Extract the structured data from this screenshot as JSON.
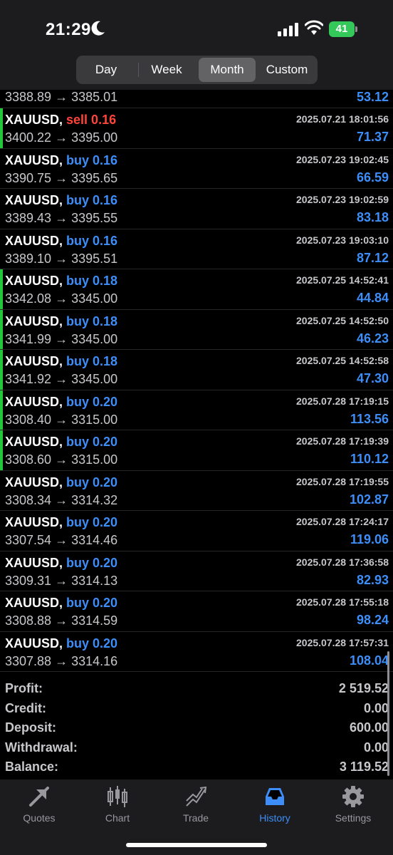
{
  "status": {
    "time": "21:29",
    "battery": "41"
  },
  "periods": [
    "Day",
    "Week",
    "Month",
    "Custom"
  ],
  "active_period": "Month",
  "first_row": {
    "prices": "3388.89 → 3385.01",
    "profit": "53.12"
  },
  "deals": [
    {
      "symbol": "XAUUSD,",
      "side": "sell",
      "side_text": "sell 0.16",
      "date": "2025.07.21 18:01:56",
      "prices": "3400.22 → 3395.00",
      "profit": "71.37",
      "marker": true
    },
    {
      "symbol": "XAUUSD,",
      "side": "buy",
      "side_text": "buy 0.16",
      "date": "2025.07.23 19:02:45",
      "prices": "3390.75 → 3395.65",
      "profit": "66.59",
      "marker": false
    },
    {
      "symbol": "XAUUSD,",
      "side": "buy",
      "side_text": "buy 0.16",
      "date": "2025.07.23 19:02:59",
      "prices": "3389.43 → 3395.55",
      "profit": "83.18",
      "marker": false
    },
    {
      "symbol": "XAUUSD,",
      "side": "buy",
      "side_text": "buy 0.16",
      "date": "2025.07.23 19:03:10",
      "prices": "3389.10 → 3395.51",
      "profit": "87.12",
      "marker": false
    },
    {
      "symbol": "XAUUSD,",
      "side": "buy",
      "side_text": "buy 0.18",
      "date": "2025.07.25 14:52:41",
      "prices": "3342.08 → 3345.00",
      "profit": "44.84",
      "marker": true
    },
    {
      "symbol": "XAUUSD,",
      "side": "buy",
      "side_text": "buy 0.18",
      "date": "2025.07.25 14:52:50",
      "prices": "3341.99 → 3345.00",
      "profit": "46.23",
      "marker": true
    },
    {
      "symbol": "XAUUSD,",
      "side": "buy",
      "side_text": "buy 0.18",
      "date": "2025.07.25 14:52:58",
      "prices": "3341.92 → 3345.00",
      "profit": "47.30",
      "marker": true
    },
    {
      "symbol": "XAUUSD,",
      "side": "buy",
      "side_text": "buy 0.20",
      "date": "2025.07.28 17:19:15",
      "prices": "3308.40 → 3315.00",
      "profit": "113.56",
      "marker": true
    },
    {
      "symbol": "XAUUSD,",
      "side": "buy",
      "side_text": "buy 0.20",
      "date": "2025.07.28 17:19:39",
      "prices": "3308.60 → 3315.00",
      "profit": "110.12",
      "marker": true
    },
    {
      "symbol": "XAUUSD,",
      "side": "buy",
      "side_text": "buy 0.20",
      "date": "2025.07.28 17:19:55",
      "prices": "3308.34 → 3314.32",
      "profit": "102.87",
      "marker": false
    },
    {
      "symbol": "XAUUSD,",
      "side": "buy",
      "side_text": "buy 0.20",
      "date": "2025.07.28 17:24:17",
      "prices": "3307.54 → 3314.46",
      "profit": "119.06",
      "marker": false
    },
    {
      "symbol": "XAUUSD,",
      "side": "buy",
      "side_text": "buy 0.20",
      "date": "2025.07.28 17:36:58",
      "prices": "3309.31 → 3314.13",
      "profit": "82.93",
      "marker": false
    },
    {
      "symbol": "XAUUSD,",
      "side": "buy",
      "side_text": "buy 0.20",
      "date": "2025.07.28 17:55:18",
      "prices": "3308.88 → 3314.59",
      "profit": "98.24",
      "marker": false
    },
    {
      "symbol": "XAUUSD,",
      "side": "buy",
      "side_text": "buy 0.20",
      "date": "2025.07.28 17:57:31",
      "prices": "3307.88 → 3314.16",
      "profit": "108.04",
      "marker": false
    }
  ],
  "summary": [
    {
      "label": "Profit:",
      "value": "2 519.52"
    },
    {
      "label": "Credit:",
      "value": "0.00"
    },
    {
      "label": "Deposit:",
      "value": "600.00"
    },
    {
      "label": "Withdrawal:",
      "value": "0.00"
    },
    {
      "label": "Balance:",
      "value": "3 119.52"
    }
  ],
  "tabs": [
    {
      "label": "Quotes",
      "icon": "quotes-icon"
    },
    {
      "label": "Chart",
      "icon": "chart-icon"
    },
    {
      "label": "Trade",
      "icon": "trade-icon"
    },
    {
      "label": "History",
      "icon": "history-icon"
    },
    {
      "label": "Settings",
      "icon": "settings-icon"
    }
  ],
  "active_tab": "History",
  "colors": {
    "buy": "#3d8ef8",
    "sell": "#ff453a",
    "marker": "#23c53a",
    "accent": "#3d8ef8"
  }
}
